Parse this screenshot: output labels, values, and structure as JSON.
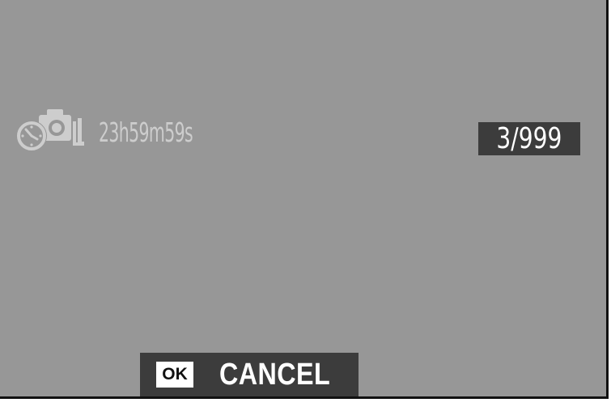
{
  "interval_timer": {
    "icon": "interval-timer-shooting-icon",
    "time_remaining": "23h59m59s"
  },
  "frame_counter": {
    "value": "3/999"
  },
  "cancel_control": {
    "button_label": "OK",
    "action_label": "CANCEL"
  },
  "colors": {
    "screen_background": "#979797",
    "panel_background": "#3c3c3c",
    "dim_text": "#cdcdcd",
    "bright_text": "#ffffff"
  }
}
